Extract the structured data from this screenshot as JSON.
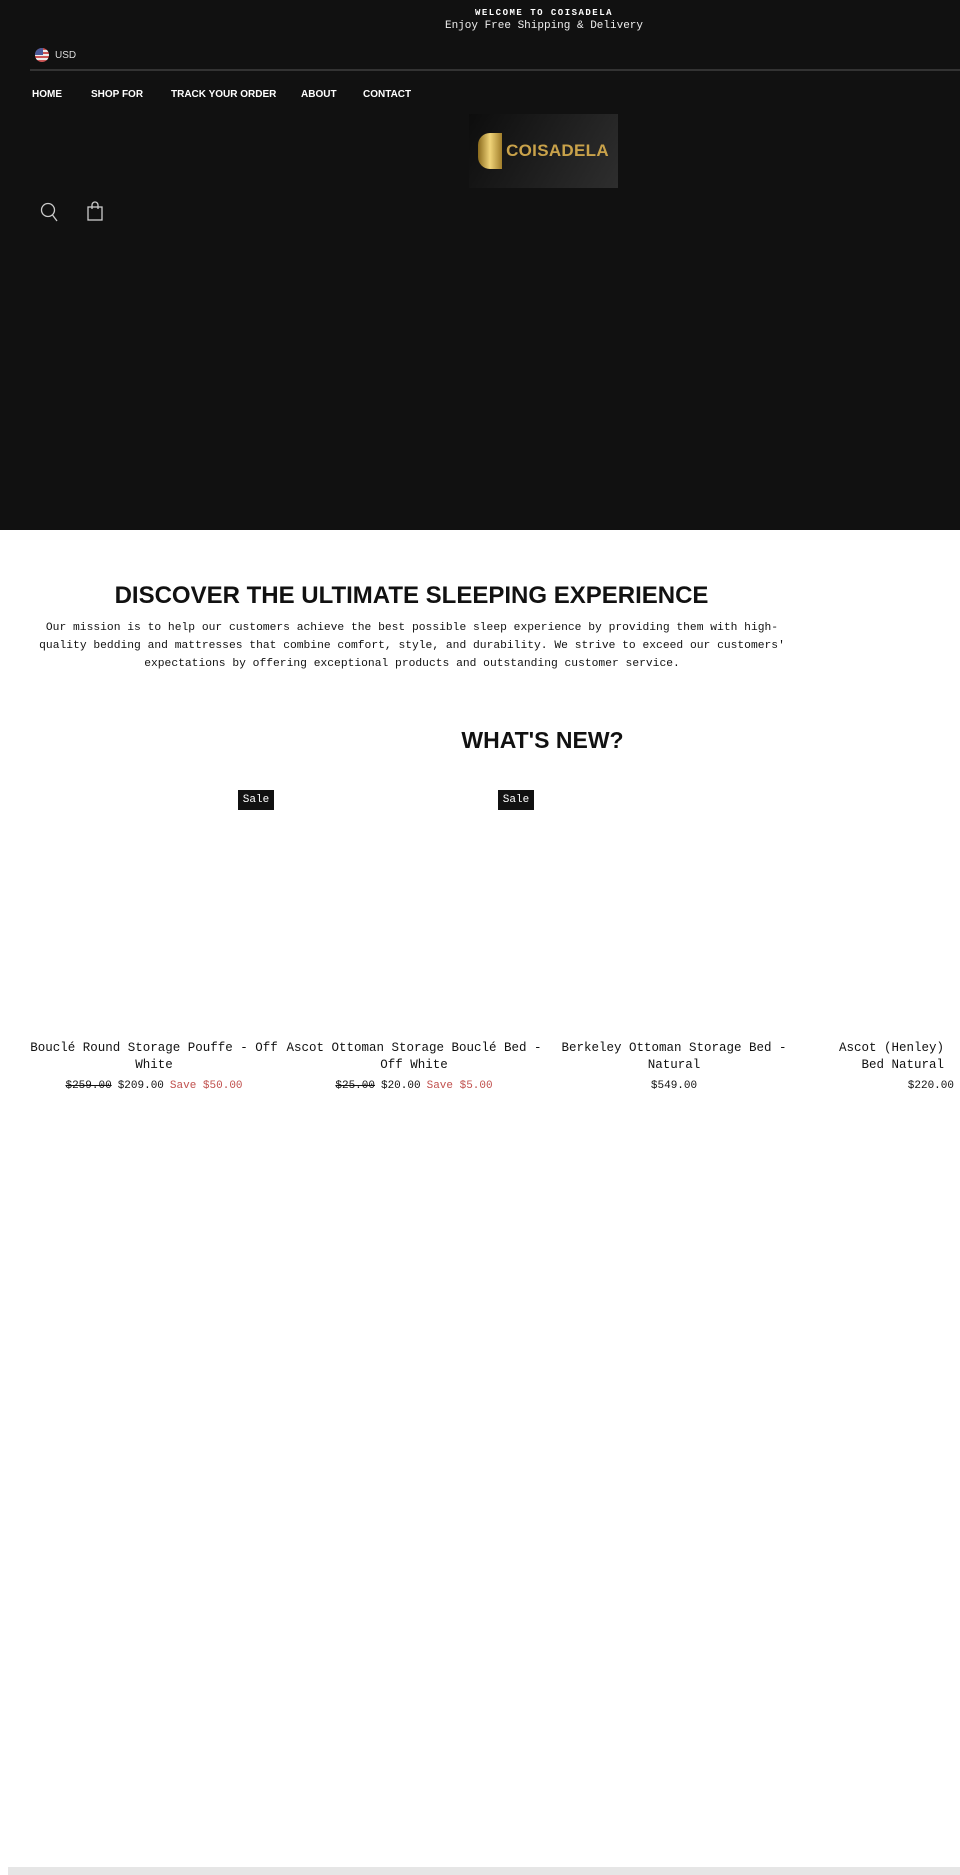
{
  "announcement": {
    "title": "WELCOME TO COISADELA",
    "subtitle": "Enjoy Free Shipping & Delivery"
  },
  "currency": {
    "label": "USD",
    "icon": "us-flag-icon"
  },
  "nav": [
    "HOME",
    "SHOP FOR",
    "TRACK YOUR ORDER",
    "ABOUT",
    "CONTACT"
  ],
  "logo": {
    "text": "COISADELA"
  },
  "icons": [
    "search-icon",
    "cart-icon"
  ],
  "mission": {
    "heading": "DISCOVER THE ULTIMATE SLEEPING EXPERIENCE",
    "text": "Our mission is to help our customers achieve the best possible sleep experience by providing them with high-quality bedding and mattresses that combine comfort, style, and durability. We strive to exceed our customers' expectations by offering exceptional products and outstanding customer service."
  },
  "whats_new": {
    "heading": "WHAT'S NEW?",
    "products": [
      {
        "badge": "Sale",
        "title": "Bouclé Round Storage Pouffe - Off White",
        "old_price": "$259.00",
        "price": "$209.00",
        "save": "Save $50.00"
      },
      {
        "badge": "Sale",
        "title": "Ascot Ottoman Storage Bouclé Bed - Off White",
        "old_price": "$25.00",
        "price": "$20.00",
        "save": "Save $5.00"
      },
      {
        "title": "Berkeley Ottoman Storage Bed - Natural",
        "price": "$549.00"
      },
      {
        "title": "Ascot (Henley) Bed Natural",
        "price": "$220.00"
      }
    ]
  },
  "colors": {
    "header_bg": "#111111",
    "sale_text": "#c0504d",
    "logo_gold": "#c9a24a"
  }
}
